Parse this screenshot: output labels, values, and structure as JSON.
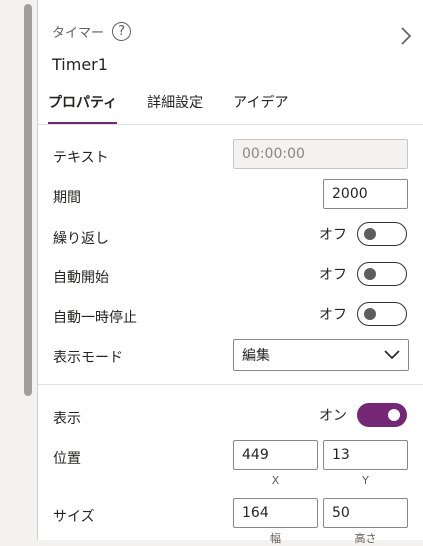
{
  "header": {
    "kind": "タイマー",
    "help_icon": "?",
    "control_name": "Timer1"
  },
  "tabs": [
    {
      "label": "プロパティ",
      "active": true
    },
    {
      "label": "詳細設定",
      "active": false
    },
    {
      "label": "アイデア",
      "active": false
    }
  ],
  "properties": {
    "text": {
      "label": "テキスト",
      "value": "00:00:00"
    },
    "duration": {
      "label": "期間",
      "value": "2000"
    },
    "repeat": {
      "label": "繰り返し",
      "state": "オフ",
      "on": false
    },
    "autostart": {
      "label": "自動開始",
      "state": "オフ",
      "on": false
    },
    "autopause": {
      "label": "自動一時停止",
      "state": "オフ",
      "on": false
    },
    "display_mode": {
      "label": "表示モード",
      "value": "編集"
    }
  },
  "layout": {
    "visible": {
      "label": "表示",
      "state": "オン",
      "on": true
    },
    "position": {
      "label": "位置",
      "x": "449",
      "y": "13",
      "x_label": "X",
      "y_label": "Y"
    },
    "size": {
      "label": "サイズ",
      "width": "164",
      "height": "50",
      "width_label": "幅",
      "height_label": "高さ"
    }
  },
  "colors": {
    "accent": "#742774"
  }
}
